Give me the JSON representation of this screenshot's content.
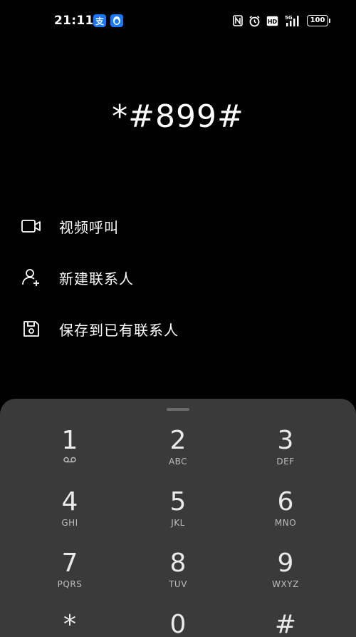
{
  "status_bar": {
    "time": "21:11",
    "battery": "100",
    "network": "5G",
    "hd_label": "HD"
  },
  "dialer": {
    "number": "*#899#"
  },
  "actions": [
    {
      "label": "视频呼叫",
      "icon": "video-camera-icon"
    },
    {
      "label": "新建联系人",
      "icon": "add-person-icon"
    },
    {
      "label": "保存到已有联系人",
      "icon": "save-floppy-icon"
    }
  ],
  "keypad": {
    "keys": [
      {
        "digit": "1",
        "letters": ""
      },
      {
        "digit": "2",
        "letters": "ABC"
      },
      {
        "digit": "3",
        "letters": "DEF"
      },
      {
        "digit": "4",
        "letters": "GHI"
      },
      {
        "digit": "5",
        "letters": "JKL"
      },
      {
        "digit": "6",
        "letters": "MNO"
      },
      {
        "digit": "7",
        "letters": "PQRS"
      },
      {
        "digit": "8",
        "letters": "TUV"
      },
      {
        "digit": "9",
        "letters": "WXYZ"
      },
      {
        "digit": "*",
        "letters": ""
      },
      {
        "digit": "0",
        "letters": ""
      },
      {
        "digit": "#",
        "letters": ""
      }
    ]
  },
  "colors": {
    "background": "#000000",
    "keypad_bg": "#3a3a3a",
    "app_icon_blue": "#1677ff"
  }
}
